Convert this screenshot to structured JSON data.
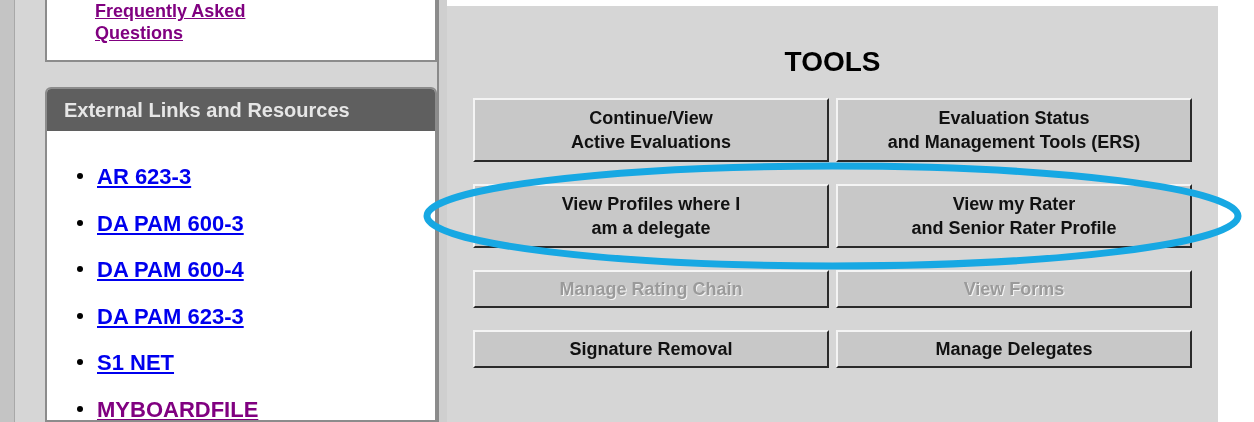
{
  "sidebar": {
    "faq_link": {
      "label": "Frequently Asked Questions",
      "visited": true
    },
    "resources": {
      "title": "External Links and Resources",
      "links": [
        {
          "label": "AR 623-3",
          "visited": false
        },
        {
          "label": "DA PAM 600-3",
          "visited": false
        },
        {
          "label": "DA PAM 600-4",
          "visited": false
        },
        {
          "label": "DA PAM 623-3",
          "visited": false
        },
        {
          "label": "S1 NET",
          "visited": false
        },
        {
          "label": "MYBOARDFILE",
          "visited": true
        }
      ]
    }
  },
  "tools": {
    "title": "TOOLS",
    "rows": [
      {
        "circled": false,
        "buttons": [
          {
            "label": "Continue/View\nActive Evaluations",
            "disabled": false
          },
          {
            "label": "Evaluation Status\nand Management Tools (ERS)",
            "disabled": false
          }
        ]
      },
      {
        "circled": true,
        "buttons": [
          {
            "label": "View Profiles where I\nam a delegate",
            "disabled": false
          },
          {
            "label": "View my Rater\nand Senior Rater Profile",
            "disabled": false
          }
        ]
      },
      {
        "circled": false,
        "buttons": [
          {
            "label": "Manage Rating Chain",
            "disabled": true
          },
          {
            "label": "View Forms",
            "disabled": true
          }
        ]
      },
      {
        "circled": false,
        "buttons": [
          {
            "label": "Signature Removal",
            "disabled": false
          },
          {
            "label": "Manage Delegates",
            "disabled": false
          }
        ]
      }
    ]
  }
}
